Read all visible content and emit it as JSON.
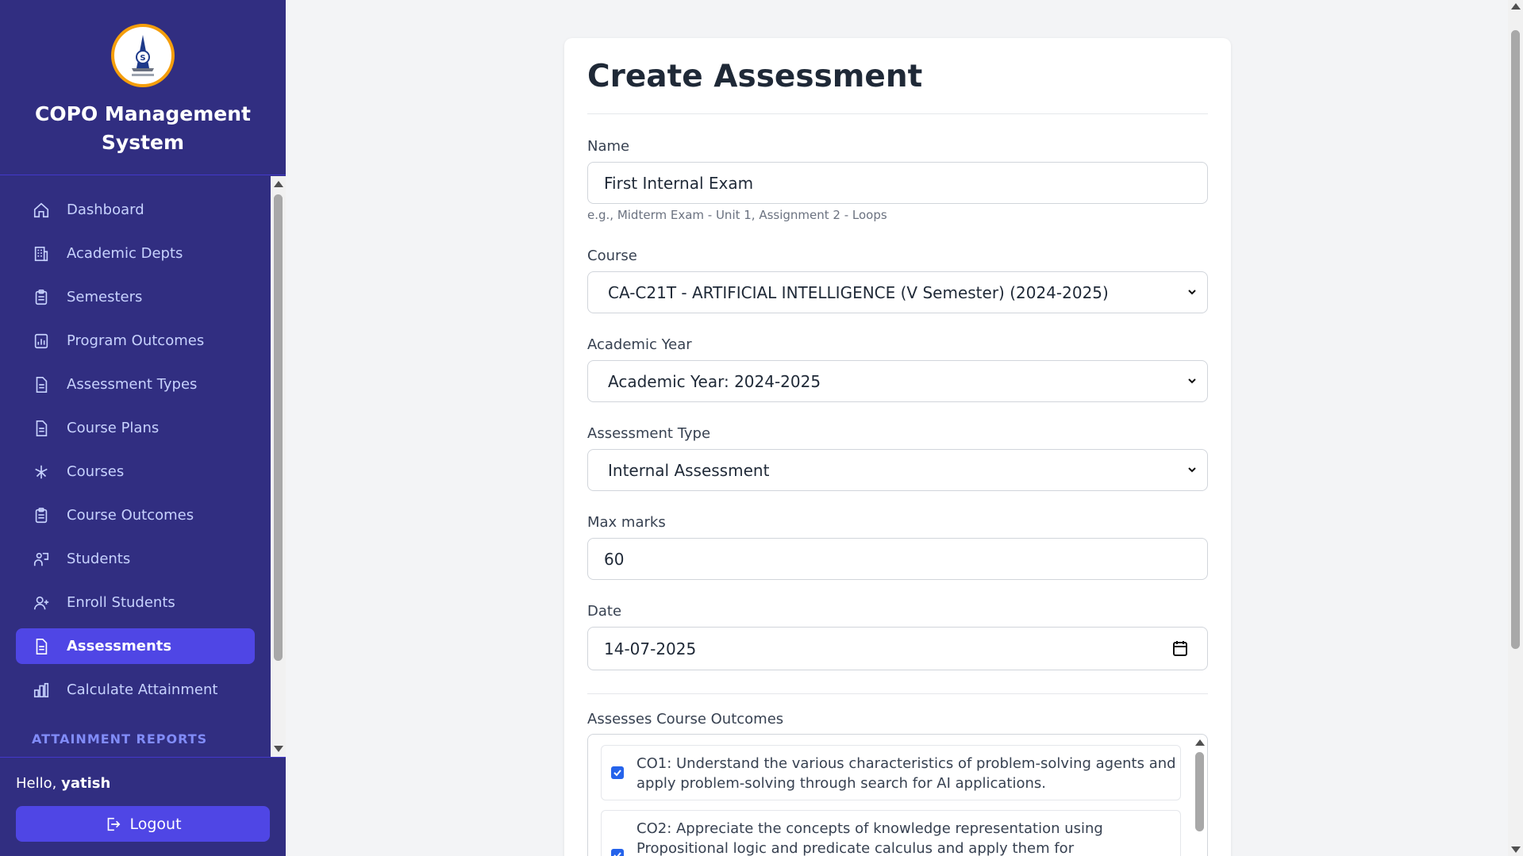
{
  "app": {
    "title": "COPO Management System",
    "logo_icon": "soundarya-logo-icon"
  },
  "sidebar": {
    "items": [
      {
        "label": "Dashboard",
        "icon": "home-icon"
      },
      {
        "label": "Academic Depts",
        "icon": "building-icon"
      },
      {
        "label": "Semesters",
        "icon": "clipboard-icon"
      },
      {
        "label": "Program Outcomes",
        "icon": "chart-doc-icon"
      },
      {
        "label": "Assessment Types",
        "icon": "document-icon"
      },
      {
        "label": "Course Plans",
        "icon": "document-icon"
      },
      {
        "label": "Courses",
        "icon": "network-icon"
      },
      {
        "label": "Course Outcomes",
        "icon": "clipboard-icon"
      },
      {
        "label": "Students",
        "icon": "student-icon"
      },
      {
        "label": "Enroll Students",
        "icon": "user-plus-icon"
      },
      {
        "label": "Assessments",
        "icon": "document-icon",
        "active": true
      },
      {
        "label": "Calculate Attainment",
        "icon": "bar-chart-icon"
      }
    ],
    "section_label": "ATTAINMENT REPORTS"
  },
  "user": {
    "greeting": "Hello,",
    "name": "yatish",
    "logout_label": "Logout"
  },
  "form": {
    "title": "Create Assessment",
    "name_label": "Name",
    "name_value": "First Internal Exam",
    "name_hint": "e.g., Midterm Exam - Unit 1, Assignment 2 - Loops",
    "course_label": "Course",
    "course_value": "CA-C21T - ARTIFICIAL INTELLIGENCE (V Semester) (2024-2025)",
    "year_label": "Academic Year",
    "year_value": "Academic Year: 2024-2025",
    "type_label": "Assessment Type",
    "type_value": "Internal Assessment",
    "max_label": "Max marks",
    "max_value": "60",
    "date_label": "Date",
    "date_value": "14-07-2025",
    "co_label": "Assesses Course Outcomes",
    "course_outcomes": [
      {
        "text": "CO1: Understand the various characteristics of problem-solving agents and apply problem-solving through search for AI applications.",
        "checked": true
      },
      {
        "text": "CO2: Appreciate the concepts of knowledge representation using Propositional logic and predicate calculus and apply them for",
        "checked": true
      }
    ]
  },
  "colors": {
    "sidebar_bg": "#312e81",
    "active_bg": "#4f46e5",
    "page_bg": "#f3f4f6"
  }
}
